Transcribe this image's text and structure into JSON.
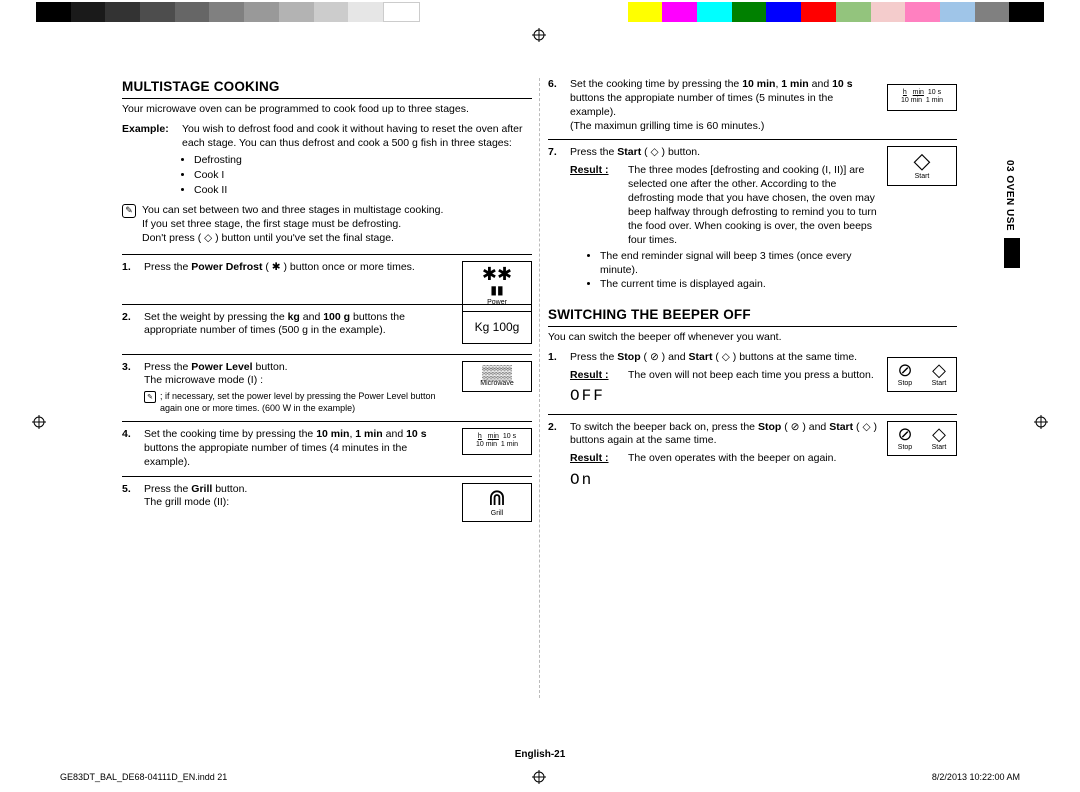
{
  "sideTab": "03  OVEN USE",
  "pageLabel": "English-21",
  "footLeft": "GE83DT_BAL_DE68-04111D_EN.indd   21",
  "footRight": "8/2/2013   10:22:00 AM",
  "left": {
    "h": "MULTISTAGE COOKING",
    "intro": "Your microwave oven can be programmed to cook food up to three stages.",
    "exampleLabel": "Example:",
    "exampleText": "You wish to defrost food and cook it without having to reset the oven after each stage. You can thus defrost and cook a 500 g fish in three stages:",
    "b1": "Defrosting",
    "b2": "Cook I",
    "b3": "Cook II",
    "note1a": "You can set between two and three stages in multistage cooking.",
    "note1b": "If you set three stage, the first stage must be defrosting.",
    "note1c": "Don't press ( ◇ ) button until you've set the final stage.",
    "s1a": "Press the ",
    "s1b": "Power Defrost",
    "s1c": " ( ✱ ) button once or more times.",
    "icon1": "✱✱",
    "icon1b": "▮▮",
    "icon1lbl": "Power",
    "s2a": "Set the weight by pressing the ",
    "s2b": "kg",
    "s2c": " and ",
    "s2d": "100 g",
    "s2e": " buttons the appropriate number of times (500 g in the example).",
    "icon2": "Kg   100g",
    "s3a": "Press the ",
    "s3b": "Power Level",
    "s3c": " button.",
    "s3d": "The microwave mode (I) :",
    "s3note": "; if necessary, set the power level by pressing the Power Level button again one or more times. (600 W in the example)",
    "icon3": "▒▒▒",
    "icon3lbl": "Microwave",
    "s4a": "Set the cooking time by pressing the ",
    "s4b": "10 min",
    "s4c": ", ",
    "s4d": "1 min",
    "s4e": " and ",
    "s4f": "10 s",
    "s4g": " buttons the appropiate number of times (4 minutes in the example).",
    "icon4a": "h",
    "icon4b": "min",
    "icon4c": "10 s",
    "icon4d": "10 min",
    "icon4e": "1 min",
    "s5a": "Press the ",
    "s5b": "Grill",
    "s5c": " button.",
    "s5d": "The grill mode (II):",
    "icon5": "⋒",
    "icon5lbl": "Grill"
  },
  "right": {
    "s6a": "Set the cooking time by pressing the ",
    "s6b": "10 min",
    "s6c": ", ",
    "s6d": "1 min",
    "s6e": " and ",
    "s6f": "10 s",
    "s6g": " buttons the appropiate number of times (5 minutes in the example).",
    "s6h": "(The maximun grilling time is 60 minutes.)",
    "s7a": "Press the ",
    "s7b": "Start",
    "s7c": " ( ◇ ) button.",
    "icon7": "◇",
    "icon7lbl": "Start",
    "resLbl": "Result :",
    "res7": "The three modes [defrosting and cooking (I, II)] are selected one after the other. According to the defrosting mode that you have chosen, the oven may beep halfway through defrosting to remind you to turn the food over. When cooking is over, the oven beeps four times.",
    "res7b1": "The end reminder signal will beep 3 times (once every minute).",
    "res7b2": "The current time is displayed again.",
    "h2": "SWITCHING THE BEEPER OFF",
    "intro2": "You can switch the beeper off whenever you want.",
    "b1a": "Press the ",
    "b1b": "Stop",
    "b1c": " ( ⊘ ) and ",
    "b1d": "Start",
    "b1e": " ( ◇ ) buttons at the same time.",
    "iconStop": "⊘",
    "iconStopLbl": "Stop",
    "iconStart": "◇",
    "iconStartLbl": "Start",
    "res1": "The oven will not beep each time you press a button.",
    "seg1": "OFF",
    "b2a": "To switch the beeper back on, press the ",
    "b2b": "Stop",
    "b2c": " ( ⊘ ) and ",
    "b2d": "Start",
    "b2e": " ( ◇ ) buttons again at the same time.",
    "res2": "The oven operates with the beeper on again.",
    "seg2": "On"
  }
}
